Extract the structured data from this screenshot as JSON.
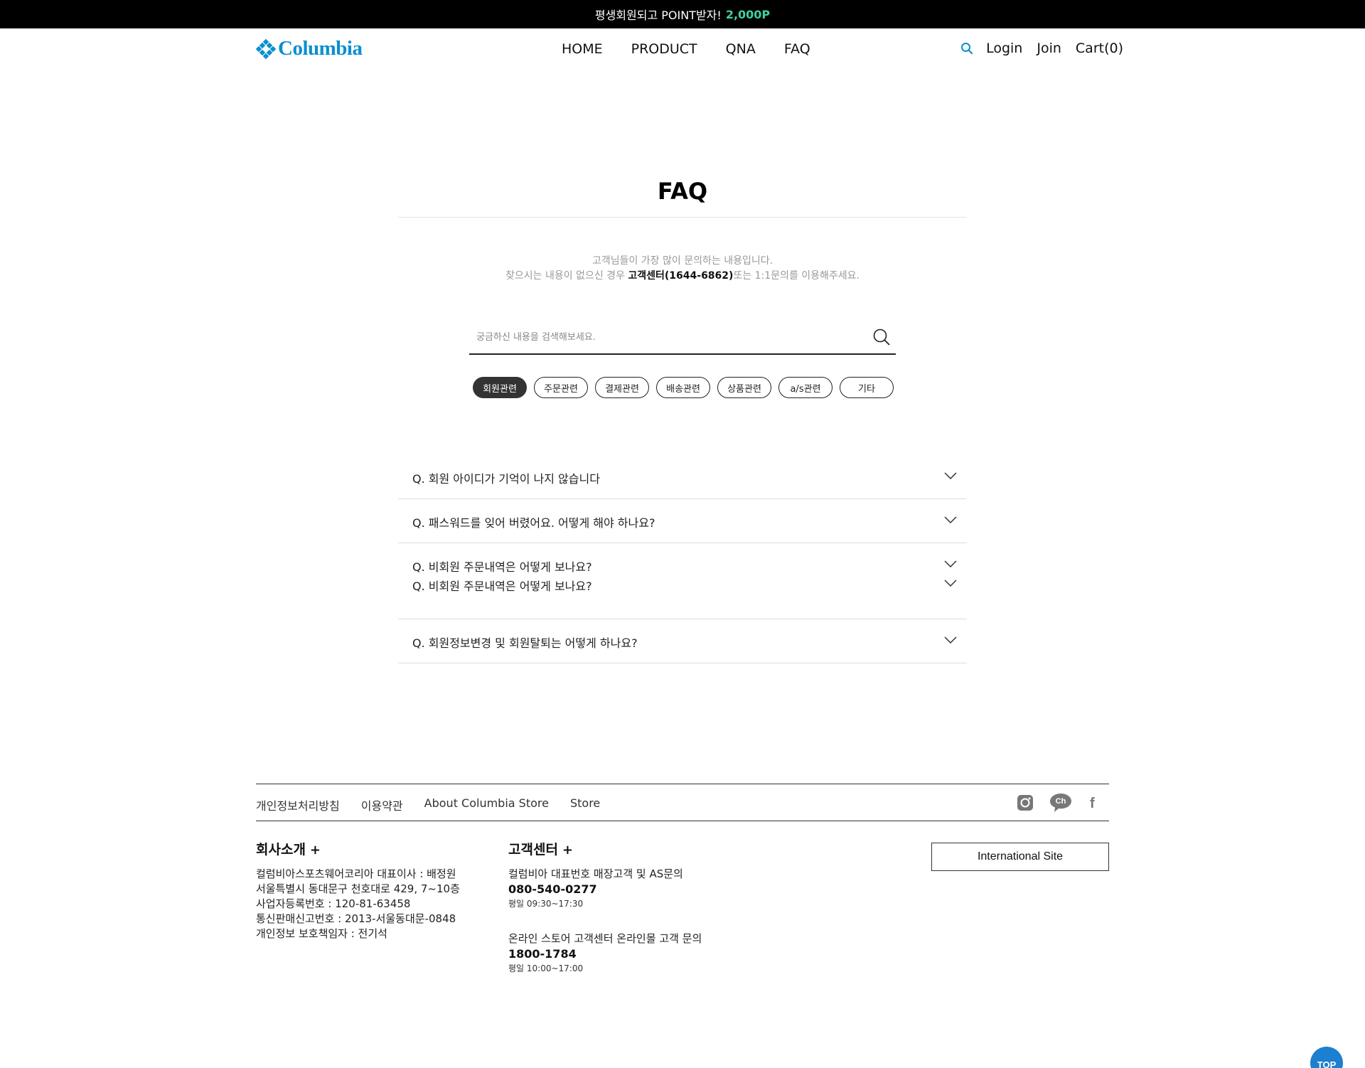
{
  "top_banner": {
    "text": "평생회원되고 POINT받자!",
    "point": "2,000P",
    "accent_color": "#3fd0a0"
  },
  "header": {
    "logo_text": "Columbia",
    "brand_color": "#0a8fd0",
    "nav": [
      "HOME",
      "PRODUCT",
      "QNA",
      "FAQ"
    ],
    "util": {
      "login": "Login",
      "join": "Join",
      "cart": "Cart(0)"
    },
    "search_icon": "search-icon"
  },
  "faq": {
    "title": "FAQ",
    "intro_line1": "고객님들이 가장 많이 문의하는 내용입니다.",
    "intro_line2_pre": "찾으시는 내용이 없으신 경우 ",
    "intro_line2_strong": "고객센터(1644-6862)",
    "intro_line2_post": "또는 1:1문의를 이용해주세요.",
    "search_placeholder": "궁금하신 내용을 검색해보세요.",
    "categories": [
      "회원관련",
      "주문관련",
      "결제관련",
      "배송관련",
      "상품관련",
      "a/s관련",
      "기타"
    ],
    "active_category": "회원관련",
    "items": [
      "Q. 회원 아이디가 기억이 나지 않습니다",
      "Q. 패스워드를 잊어 버렸어요. 어떻게 해야 하나요?",
      "Q. 비회원 주문내역은 어떻게 보나요?",
      "Q. 비회원 주문내역은 어떻게 보나요?",
      "Q. 회원정보변경 및 회원탈퇴는 어떻게 하나요?"
    ]
  },
  "footer": {
    "links": [
      "개인정보처리방침",
      "이용약관",
      "About Columbia Store",
      "Store"
    ],
    "social_icons": [
      "instagram-icon",
      "kakao-channel-icon",
      "facebook-icon"
    ],
    "social_channel_text": "Ch",
    "social_facebook_text": "f",
    "company": {
      "title": "회사소개",
      "plus": "+",
      "lines": [
        "컬럼비아스포츠웨어코리아 대표이사 : 배정원",
        "서울특별시 동대문구 천호대로 429, 7~10층",
        "사업자등록번호 : 120-81-63458",
        "통신판매신고번호 : 2013-서울동대문-0848",
        "개인정보 보호책임자 : 전기석"
      ]
    },
    "cs": {
      "title": "고객센터",
      "plus": "+",
      "blocks": [
        {
          "label": "컬럼비아 대표번호 매장고객 및 AS문의",
          "tel": "080-540-0277",
          "hours": "평일 09:30~17:30"
        },
        {
          "label": "온라인 스토어 고객센터 온라인몰 고객 문의",
          "tel": "1800-1784",
          "hours": "평일 10:00~17:00"
        }
      ]
    },
    "international": "International Site"
  },
  "top_button": "TOP"
}
